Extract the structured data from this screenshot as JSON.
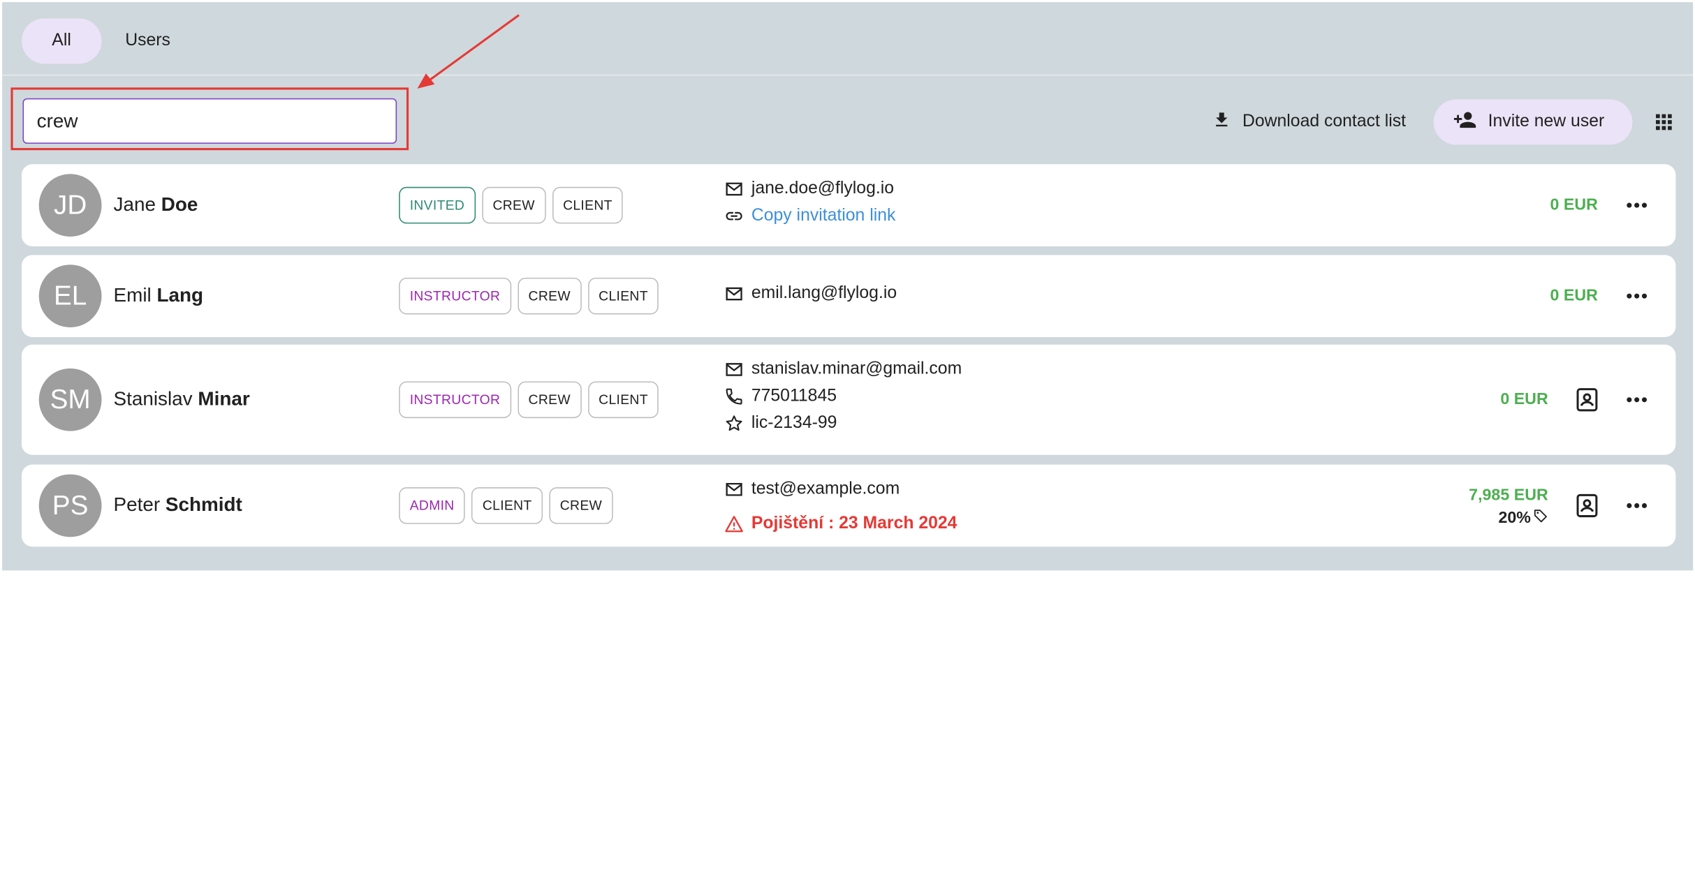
{
  "tabs": [
    {
      "label": "All",
      "active": true
    },
    {
      "label": "Users",
      "active": false
    }
  ],
  "search": {
    "value": "crew",
    "placeholder": ""
  },
  "toolbar": {
    "download_label": "Download contact list",
    "invite_label": "Invite new user",
    "icons": {
      "download": "download-icon",
      "invite": "person-add-icon",
      "view": "grid-view-icon"
    }
  },
  "colors": {
    "background": "#cfd8dc",
    "accent": "#7e3fc7",
    "tab_active_bg": "#ebe3f7",
    "amount_green": "#4caf50",
    "link_blue": "#3d8fd9",
    "warning_red": "#e53935",
    "invited_green": "#2e8b70",
    "role_purple": "#9c27b0"
  },
  "users": [
    {
      "initials": "JD",
      "first_name": "Jane",
      "last_name": "Doe",
      "roles": [
        {
          "label": "INVITED",
          "style": "invited"
        },
        {
          "label": "CREW",
          "style": "default"
        },
        {
          "label": "CLIENT",
          "style": "default"
        }
      ],
      "contacts": [
        {
          "icon": "mail-icon",
          "text": "jane.doe@flylog.io",
          "kind": "text"
        },
        {
          "icon": "link-icon",
          "text": "Copy invitation link",
          "kind": "link"
        }
      ],
      "amount": "0 EUR"
    },
    {
      "initials": "EL",
      "first_name": "Emil",
      "last_name": "Lang",
      "roles": [
        {
          "label": "INSTRUCTOR",
          "style": "purple"
        },
        {
          "label": "CREW",
          "style": "default"
        },
        {
          "label": "CLIENT",
          "style": "default"
        }
      ],
      "contacts": [
        {
          "icon": "mail-icon",
          "text": "emil.lang@flylog.io",
          "kind": "text"
        }
      ],
      "amount": "0 EUR"
    },
    {
      "initials": "SM",
      "first_name": "Stanislav",
      "last_name": "Minar",
      "roles": [
        {
          "label": "INSTRUCTOR",
          "style": "purple"
        },
        {
          "label": "CREW",
          "style": "default"
        },
        {
          "label": "CLIENT",
          "style": "default"
        }
      ],
      "contacts": [
        {
          "icon": "mail-icon",
          "text": "stanislav.minar@gmail.com",
          "kind": "text"
        },
        {
          "icon": "phone-icon",
          "text": "775011845",
          "kind": "text"
        },
        {
          "icon": "star-icon",
          "text": "lic-2134-99",
          "kind": "text"
        }
      ],
      "amount": "0 EUR"
    },
    {
      "initials": "PS",
      "first_name": "Peter",
      "last_name": "Schmidt",
      "roles": [
        {
          "label": "ADMIN",
          "style": "purple"
        },
        {
          "label": "CLIENT",
          "style": "default"
        },
        {
          "label": "CREW",
          "style": "default"
        }
      ],
      "contacts": [
        {
          "icon": "mail-icon",
          "text": "test@example.com",
          "kind": "text"
        },
        {
          "icon": "warning-icon",
          "text": "Pojištění : 23 March 2024",
          "kind": "warning"
        }
      ],
      "amount": "7,985 EUR",
      "discount": "20%"
    }
  ]
}
